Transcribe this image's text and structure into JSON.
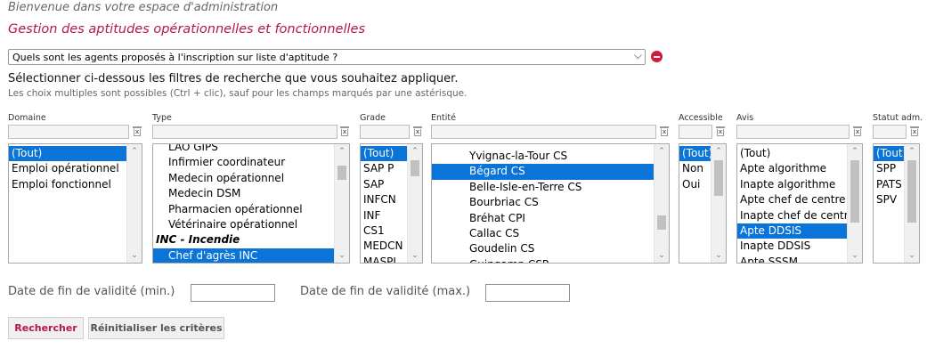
{
  "header": {
    "welcome": "Bienvenue dans votre espace d'administration",
    "section_title": "Gestion des aptitudes opérationnelles et fonctionnelles"
  },
  "query": {
    "selected": "Quels sont les agents proposés à l'inscription sur liste d'aptitude ?"
  },
  "instructions": {
    "main": "Sélectionner ci-dessous les filtres de recherche que vous souhaitez appliquer.",
    "hint": "Les choix multiples sont possibles (Ctrl + clic), sauf pour les champs marqués par une astérisque."
  },
  "filters": {
    "domaine": {
      "label": "Domaine",
      "options": [
        "(Tout)",
        "Emploi opérationnel",
        "Emploi fonctionnel"
      ],
      "selected": [
        0
      ]
    },
    "type": {
      "label": "Type",
      "options": [
        "LAO GIPS",
        "Infirmier coordinateur",
        "Medecin opérationnel",
        "Medecin DSM",
        "Pharmacien opérationnel",
        "Vétérinaire opérationnel",
        "INC - Incendie",
        "Chef d'agrès INC"
      ],
      "groups": [
        6
      ],
      "selected": [
        7
      ]
    },
    "grade": {
      "label": "Grade",
      "options": [
        "(Tout)",
        "SAP P",
        "SAP",
        "INFCN",
        "INF",
        "CS1",
        "MEDCN",
        "MASPI"
      ],
      "selected": [
        0
      ]
    },
    "entite": {
      "label": "Entité",
      "options": [
        "Yvignac-la-Tour CS",
        "Bégard CS",
        "Belle-Isle-en-Terre CS",
        "Bourbriac CS",
        "Bréhat CPI",
        "Callac CS",
        "Goudelin CS",
        "Guingamp CSP"
      ],
      "selected": [
        1
      ]
    },
    "accessible": {
      "label": "Accessible",
      "options": [
        "(Tout)",
        "Non",
        "Oui"
      ],
      "selected": [
        0
      ]
    },
    "avis": {
      "label": "Avis",
      "options": [
        "(Tout)",
        "Apte algorithme",
        "Inapte algorithme",
        "Apte chef de centre",
        "Inapte chef de centre",
        "Apte DDSIS",
        "Inapte DDSIS",
        "Apte SSSM"
      ],
      "selected": [
        5
      ]
    },
    "statut": {
      "label": "Statut adm.",
      "options": [
        "(Tout)",
        "SPP",
        "PATS",
        "SPV"
      ],
      "selected": [
        0
      ]
    },
    "clear_glyph": "x"
  },
  "dates": {
    "min_label": "Date de fin de validité (min.)",
    "min_value": "",
    "max_label": "Date de fin de validité (max.)",
    "max_value": ""
  },
  "buttons": {
    "search": "Rechercher",
    "reset": "Réinitialiser les critères"
  },
  "icons": {
    "query_remove": "remove-circle-icon",
    "filter_clear": "trash-clear-icon",
    "dropdown": "chevron-down-icon"
  },
  "colors": {
    "accent": "#b5174b",
    "selection": "#0a74d8",
    "remove": "#d11b3c"
  }
}
